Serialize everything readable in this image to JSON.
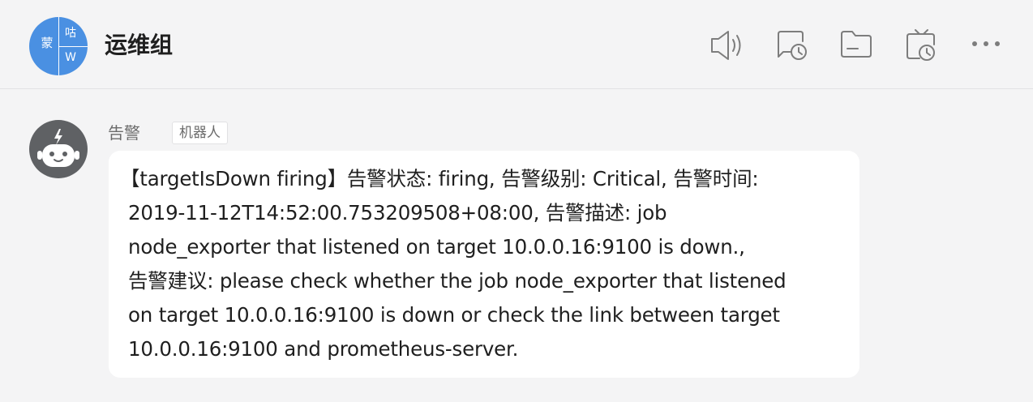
{
  "header": {
    "title": "运维组",
    "avatar_chars": [
      "蒙",
      "咕",
      "W"
    ],
    "avatar_color": "#4a90e2",
    "icons": [
      "speaker-icon",
      "chat-history-icon",
      "folder-icon",
      "live-schedule-icon",
      "more-icon"
    ]
  },
  "message": {
    "sender": "告警",
    "tag": "机器人",
    "avatar_icon": "robot-icon",
    "lines": [
      "【targetIsDown firing】告警状态: firing, 告警级别: Critical, 告警时间:",
      "2019-11-12T14:52:00.753209508+08:00, 告警描述: job",
      "node_exporter that listened on target 10.0.0.16:9100 is down.,",
      "告警建议: please check whether the job node_exporter that listened",
      "on target 10.0.0.16:9100 is down or check the link between target",
      "10.0.0.16:9100 and prometheus-server."
    ]
  }
}
